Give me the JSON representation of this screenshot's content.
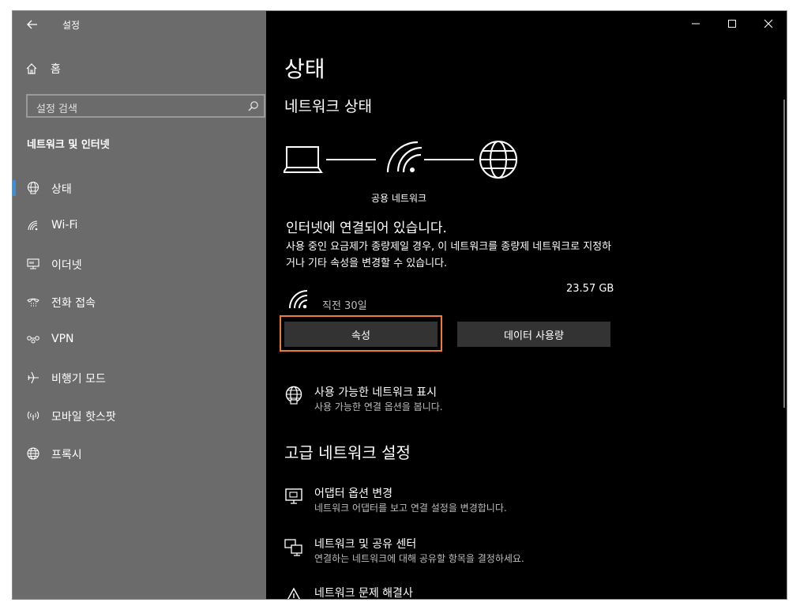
{
  "window": {
    "title": "설정"
  },
  "sidebar": {
    "home": "홈",
    "search_placeholder": "설정 검색",
    "section": "네트워크 및 인터넷",
    "items": [
      {
        "label": "상태",
        "icon": "globe-network-icon",
        "active": true
      },
      {
        "label": "Wi-Fi",
        "icon": "wifi-icon"
      },
      {
        "label": "이더넷",
        "icon": "ethernet-icon"
      },
      {
        "label": "전화 접속",
        "icon": "dialup-icon"
      },
      {
        "label": "VPN",
        "icon": "vpn-icon"
      },
      {
        "label": "비행기 모드",
        "icon": "airplane-icon"
      },
      {
        "label": "모바일 핫스팟",
        "icon": "hotspot-icon"
      },
      {
        "label": "프록시",
        "icon": "globe-icon"
      }
    ]
  },
  "main": {
    "title": "상태",
    "network_status_heading": "네트워크 상태",
    "network_type": "공용 네트워크",
    "connected_text": "인터넷에 연결되어 있습니다.",
    "description": "사용 중인 요금제가 종량제일 경우, 이 네트워크를 종량제 네트워크로 지정하거나 기타 속성을 변경할 수 있습니다.",
    "usage_size": "23.57 GB",
    "usage_period": "직전 30일",
    "btn_properties": "속성",
    "btn_data_usage": "데이터 사용량",
    "show_networks_title": "사용 가능한 네트워크 표시",
    "show_networks_sub": "사용 가능한 연결 옵션을 봅니다.",
    "advanced_heading": "고급 네트워크 설정",
    "adapter_title": "어댑터 옵션 변경",
    "adapter_sub": "네트워크 어댑터를 보고 연결 설정을 변경합니다.",
    "sharing_title": "네트워크 및 공유 센터",
    "sharing_sub": "연결하는 네트워크에 대해 공유할 항목을 결정하세요.",
    "troubleshoot_title": "네트워크 문제 해결사"
  },
  "colors": {
    "accent": "#3b8ed8",
    "highlight": "#f07a3a",
    "sidebar_bg": "#6b6b6b"
  }
}
